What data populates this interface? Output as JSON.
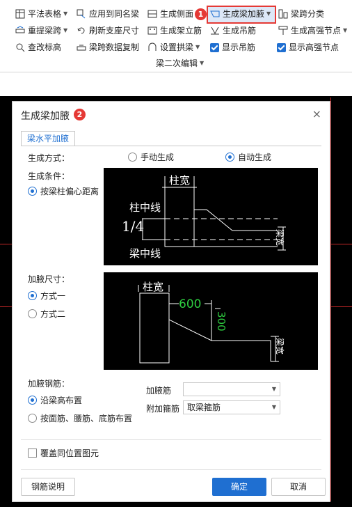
{
  "ribbon": {
    "col1": [
      "平法表格",
      "重提梁跨",
      "查改标高"
    ],
    "col2": [
      "应用到同名梁",
      "刷新支座尺寸",
      "梁跨数据复制"
    ],
    "col3": [
      "生成侧面",
      "生成架立筋",
      "设置拱梁"
    ],
    "col4": [
      "生成梁加腋",
      "生成吊筋",
      "显示吊筋"
    ],
    "col5": [
      "梁跨分类",
      "生成高强节点",
      "显示高强节点"
    ],
    "group_label": "梁二次编辑",
    "badge1": "1",
    "badge2": "2"
  },
  "dialog": {
    "title": "生成梁加腋",
    "close": "×",
    "tab": "梁水平加腋",
    "mode_label": "生成方式：",
    "mode_manual": "手动生成",
    "mode_auto": "自动生成",
    "cond_label": "生成条件：",
    "cond_option": "按梁柱偏心距离",
    "size_label": "加腋尺寸：",
    "size_opt1": "方式一",
    "size_opt2": "方式二",
    "rebar_label": "加腋钢筋：",
    "rebar_opt1": "沿梁高布置",
    "rebar_opt2": "按面筋、腰筋、底筋布置",
    "field_jyj_label": "加腋筋",
    "field_jyj_value": "",
    "field_fjgj_label": "附加箍筋",
    "field_fjgj_value": "取梁箍筋",
    "overwrite": "覆盖同位置图元",
    "btn_help": "钢筋说明",
    "btn_ok": "确定",
    "btn_cancel": "取消"
  },
  "diagram1": {
    "col_width": "柱宽",
    "col_center": "柱中线",
    "ratio": "1/4",
    "beam_center": "梁中线",
    "beam_width": "梁宽"
  },
  "diagram2": {
    "col_width": "柱宽",
    "dim_h": "600",
    "dim_v": "300",
    "beam_width": "梁宽"
  }
}
